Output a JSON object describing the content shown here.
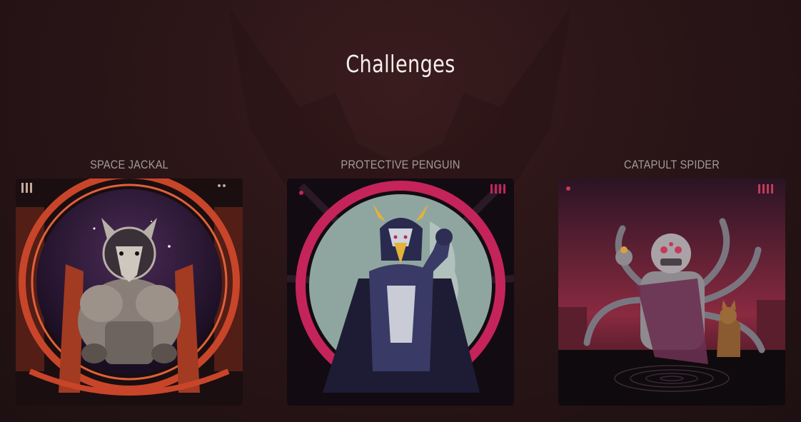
{
  "page": {
    "title": "Challenges"
  },
  "challenges": [
    {
      "name": "SPACE JACKAL",
      "art_icon": "jackal-astronaut-icon",
      "accent": "#c8452a"
    },
    {
      "name": "PROTECTIVE PENGUIN",
      "art_icon": "penguin-hero-icon",
      "accent": "#c4245a"
    },
    {
      "name": "CATAPULT SPIDER",
      "art_icon": "spider-villain-icon",
      "accent": "#b83a52"
    }
  ],
  "colors": {
    "background": "#2a1517",
    "title": "#f6efee",
    "label": "#a39a9a"
  }
}
